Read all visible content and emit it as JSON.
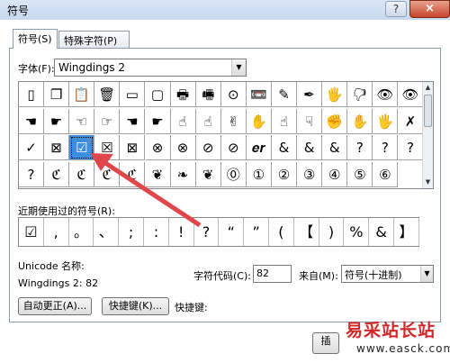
{
  "window": {
    "title": "符号",
    "help": "?",
    "close": "×"
  },
  "tabs": [
    {
      "label": "符号(S)"
    },
    {
      "label": "特殊字符(P)"
    }
  ],
  "font": {
    "label": "字体(F):",
    "value": "Wingdings 2",
    "arrow": "▼"
  },
  "symbols": [
    [
      "▯",
      "❐",
      "📋",
      "🗑",
      "▭",
      "▢",
      "🖶",
      "🖷",
      "⊙",
      "📼",
      "✎",
      "✒",
      "🖐",
      "🖓",
      "👁",
      "👁"
    ],
    [
      "☚",
      "☛",
      "☜",
      "☞",
      "☚",
      "☛",
      "☝",
      "☝",
      "✌",
      "✋",
      "☝",
      "☟",
      "✊",
      "✋",
      "🖐",
      "✗"
    ],
    [
      "✓",
      "⊠",
      "☑",
      "☒",
      "⊠",
      "⊗",
      "⊗",
      "⊘",
      "⊘",
      "𝒆𝒓",
      "&",
      "&",
      "&",
      "?",
      "?",
      "?"
    ],
    [
      "?",
      "ℭ",
      "ℭ",
      "ℭ",
      "ℭ",
      "❦",
      "❧",
      "❦",
      "⓪",
      "①",
      "②",
      "③",
      "④",
      "⑤",
      "⑥"
    ]
  ],
  "recent": {
    "label": "近期使用过的符号(R):",
    "items": [
      "☑",
      ",",
      "。",
      "、",
      ";",
      ":",
      "!",
      "?",
      "“",
      "”",
      "(",
      "【",
      ")",
      "%",
      "&",
      "】"
    ]
  },
  "unicode": {
    "name_label": "Unicode 名称:",
    "value": "Wingdings 2: 82"
  },
  "code": {
    "label": "字符代码(C):",
    "value": "82"
  },
  "from": {
    "label": "来自(M):",
    "value": "符号(十进制)",
    "arrow": "▼"
  },
  "buttons": {
    "autocorrect": "自动更正(A)...",
    "shortcut_key": "快捷键(K)...",
    "shortcut_label": "快捷键:",
    "insert": "插"
  },
  "scroll": {
    "up": "▲",
    "down": "▼"
  },
  "watermark": {
    "name": "易采站长站",
    "url": "www.easck.com"
  },
  "colors": {
    "selected": "#3c8fe0",
    "arrow": "#e0474c"
  }
}
